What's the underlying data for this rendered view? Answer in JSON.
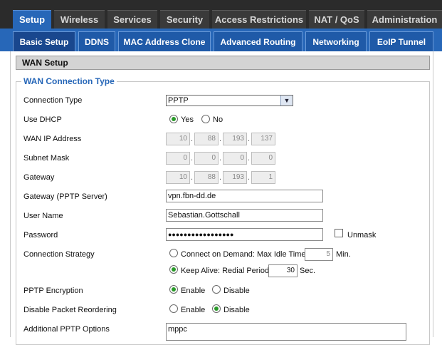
{
  "top_tabs": [
    "Setup",
    "Wireless",
    "Services",
    "Security",
    "Access Restrictions",
    "NAT / QoS",
    "Administration"
  ],
  "sub_tabs": [
    "Basic Setup",
    "DDNS",
    "MAC Address Clone",
    "Advanced Routing",
    "Networking",
    "EoIP Tunnel"
  ],
  "section_title": "WAN Setup",
  "fieldset_title": "WAN Connection Type",
  "fields": {
    "connection_type": {
      "label": "Connection Type",
      "value": "PPTP"
    },
    "use_dhcp": {
      "label": "Use DHCP",
      "yes": "Yes",
      "no": "No",
      "selected": "Yes"
    },
    "wan_ip": {
      "label": "WAN IP Address",
      "octets": [
        "10",
        "88",
        "193",
        "137"
      ]
    },
    "subnet_mask": {
      "label": "Subnet Mask",
      "octets": [
        "0",
        "0",
        "0",
        "0"
      ]
    },
    "gateway": {
      "label": "Gateway",
      "octets": [
        "10",
        "88",
        "193",
        "1"
      ]
    },
    "pptp_server": {
      "label": "Gateway (PPTP Server)",
      "value": "vpn.fbn-dd.de"
    },
    "user_name": {
      "label": "User Name",
      "value": "Sebastian.Gottschall"
    },
    "password": {
      "label": "Password",
      "value": "●●●●●●●●●●●●●●●●●",
      "unmask": "Unmask"
    },
    "connection_strategy": {
      "label": "Connection Strategy",
      "on_demand": "Connect on Demand: Max Idle Time",
      "idle_value": "5",
      "idle_unit": "Min.",
      "keep_alive": "Keep Alive: Redial Period",
      "redial_value": "30",
      "redial_unit": "Sec.",
      "selected": "Keep Alive: Redial Period"
    },
    "pptp_encryption": {
      "label": "PPTP Encryption",
      "enable": "Enable",
      "disable": "Disable",
      "selected": "Enable"
    },
    "packet_reordering": {
      "label": "Disable Packet Reordering",
      "enable": "Enable",
      "disable": "Disable",
      "selected": "Disable"
    },
    "additional_options": {
      "label": "Additional PPTP Options",
      "value": "mppc"
    }
  }
}
